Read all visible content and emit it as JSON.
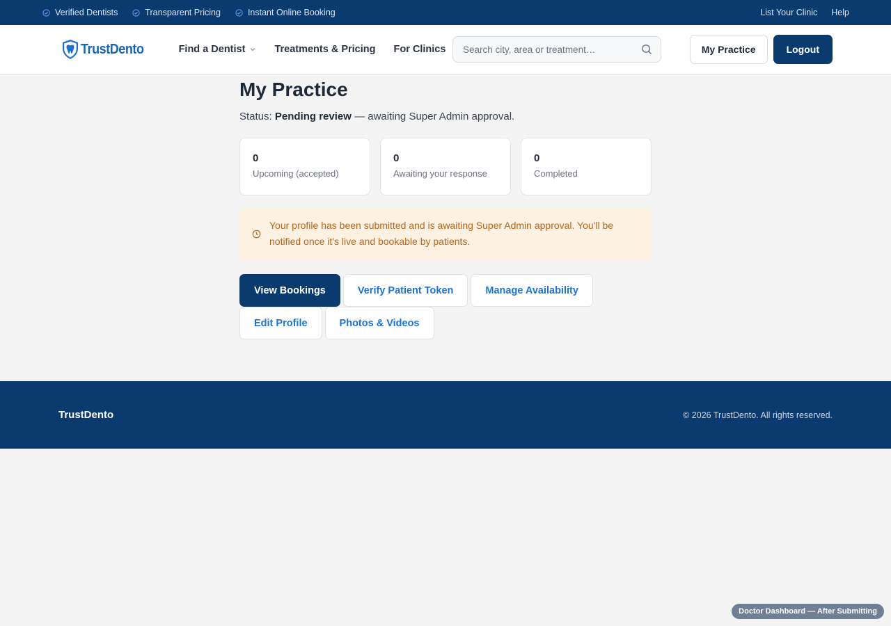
{
  "topbar": {
    "features": [
      "Verified Dentists",
      "Transparent Pricing",
      "Instant Online Booking"
    ],
    "links": [
      "List Your Clinic",
      "Help"
    ]
  },
  "header": {
    "brand": "TrustDento",
    "nav": [
      "Find a Dentist",
      "Treatments & Pricing",
      "For Clinics"
    ],
    "search_placeholder": "Search city, area or treatment…",
    "my_practice_label": "My Practice",
    "logout_label": "Logout"
  },
  "page": {
    "title": "My Practice",
    "status_prefix": "Status: ",
    "status_value": "Pending review",
    "status_suffix": " — awaiting Super Admin approval.",
    "stats": [
      {
        "value": "0",
        "label": "Upcoming (accepted)"
      },
      {
        "value": "0",
        "label": "Awaiting your response"
      },
      {
        "value": "0",
        "label": "Completed"
      }
    ],
    "notice": "Your profile has been submitted and is awaiting Super Admin approval. You'll be notified once it's live and bookable by patients.",
    "actions": [
      "View Bookings",
      "Verify Patient Token",
      "Manage Availability",
      "Edit Profile",
      "Photos & Videos"
    ]
  },
  "footer": {
    "brand": "TrustDento",
    "copyright": "© 2026 TrustDento. All rights reserved."
  },
  "badge": "Doctor Dashboard — After Submitting",
  "colors": {
    "navy": "#0b3a6e",
    "link_blue": "#1a73d9",
    "notice_bg": "#fdf1e2",
    "notice_text": "#b5661a"
  }
}
